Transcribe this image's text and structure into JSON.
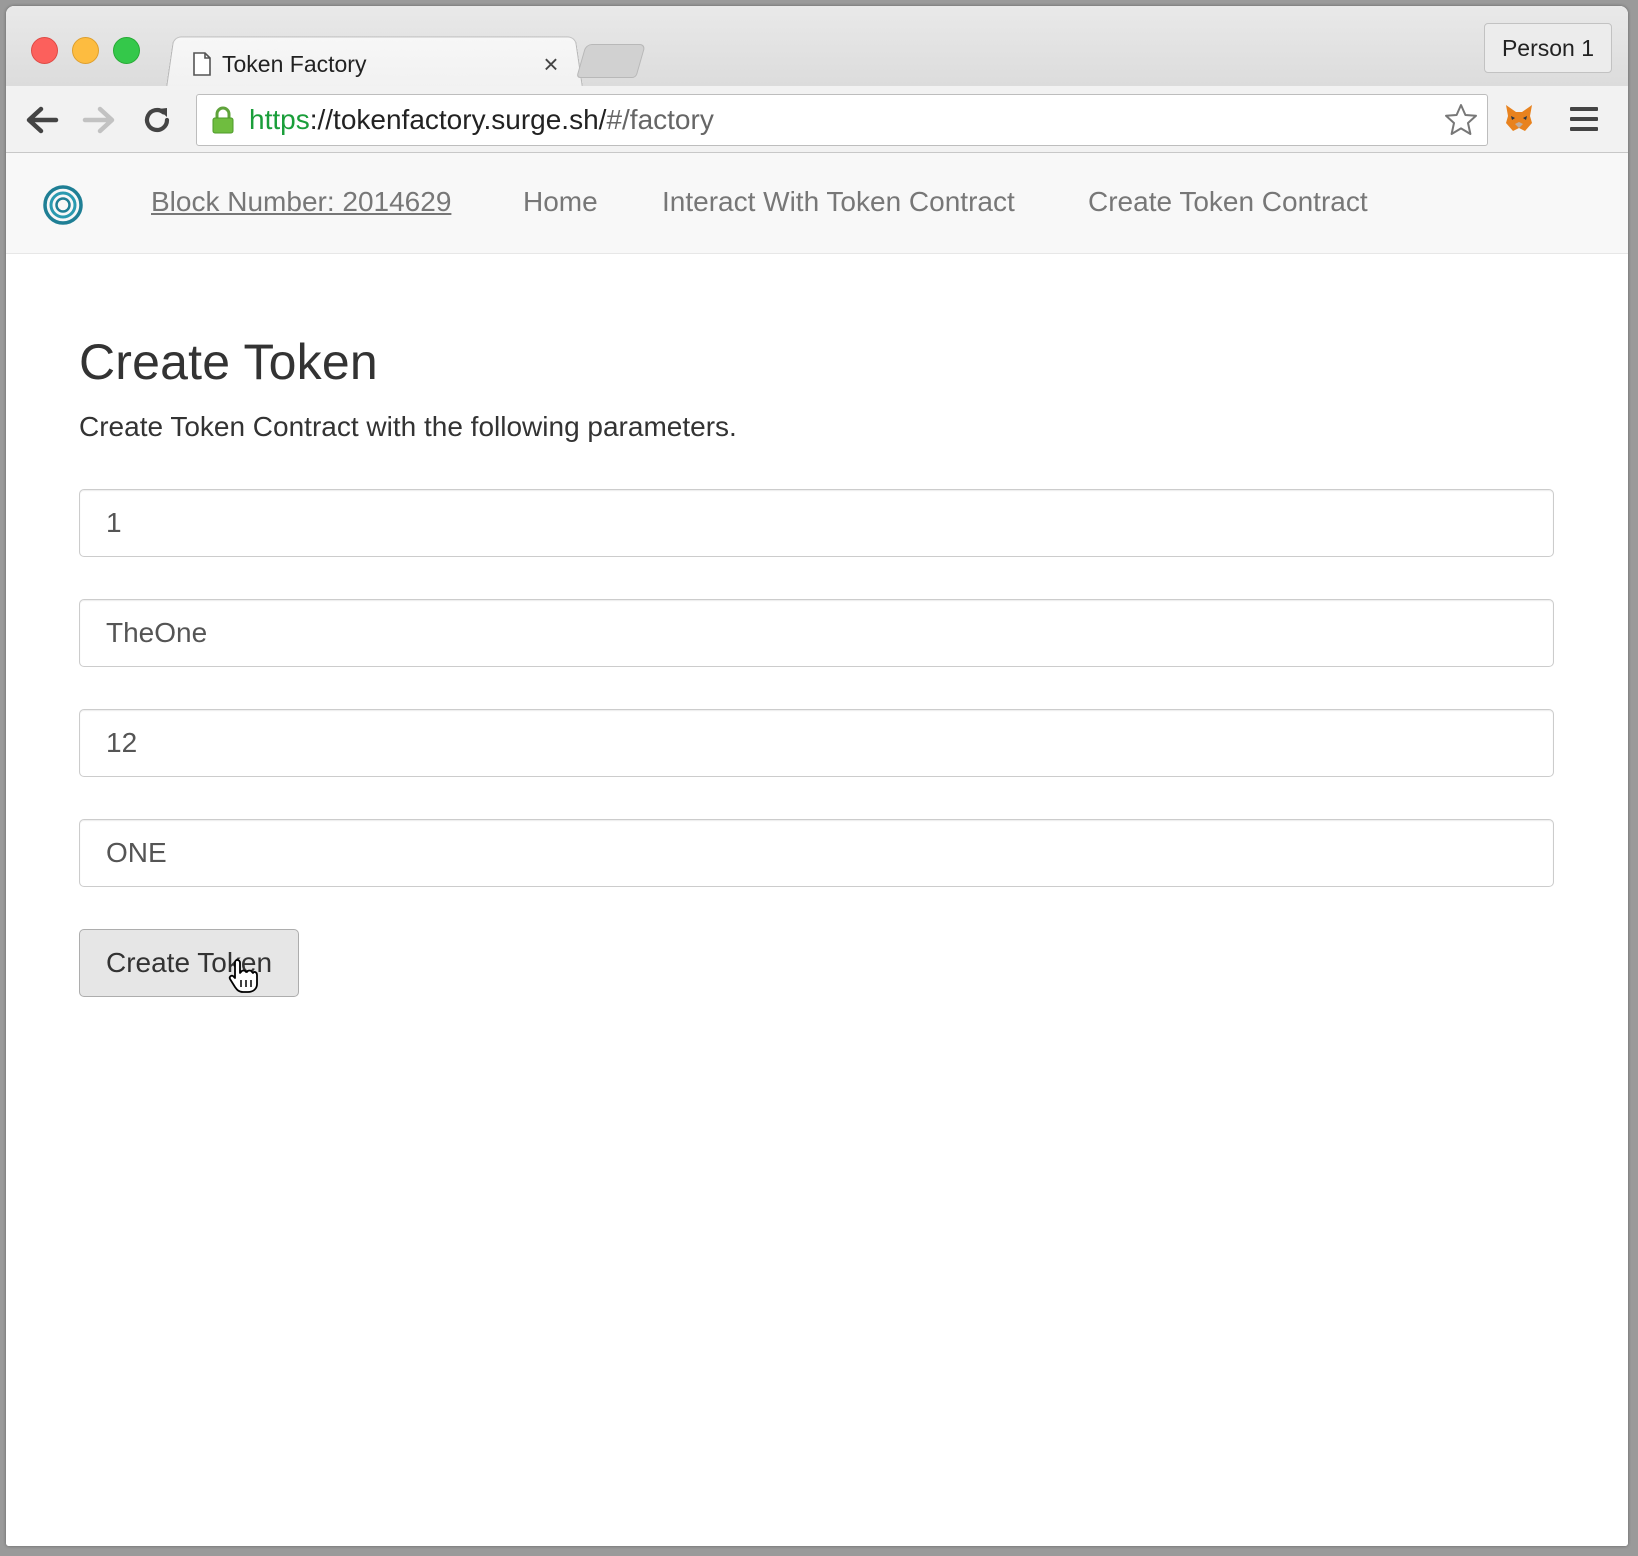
{
  "browser": {
    "tab_title": "Token Factory",
    "tab_close": "×",
    "profile_label": "Person 1",
    "url_scheme": "https",
    "url_host": "://tokenfactory.surge.sh/",
    "url_path": "#/factory"
  },
  "navbar": {
    "block_number": "Block Number: 2014629",
    "links": [
      "Home",
      "Interact With Token Contract",
      "Create Token Contract"
    ]
  },
  "main": {
    "title": "Create Token",
    "description": "Create Token Contract with the following parameters.",
    "fields": [
      "1",
      "TheOne",
      "12",
      "ONE"
    ],
    "submit_label": "Create Token"
  },
  "colors": {
    "secure_green": "#1a9e3a",
    "brand_teal": "#1f7f95"
  }
}
